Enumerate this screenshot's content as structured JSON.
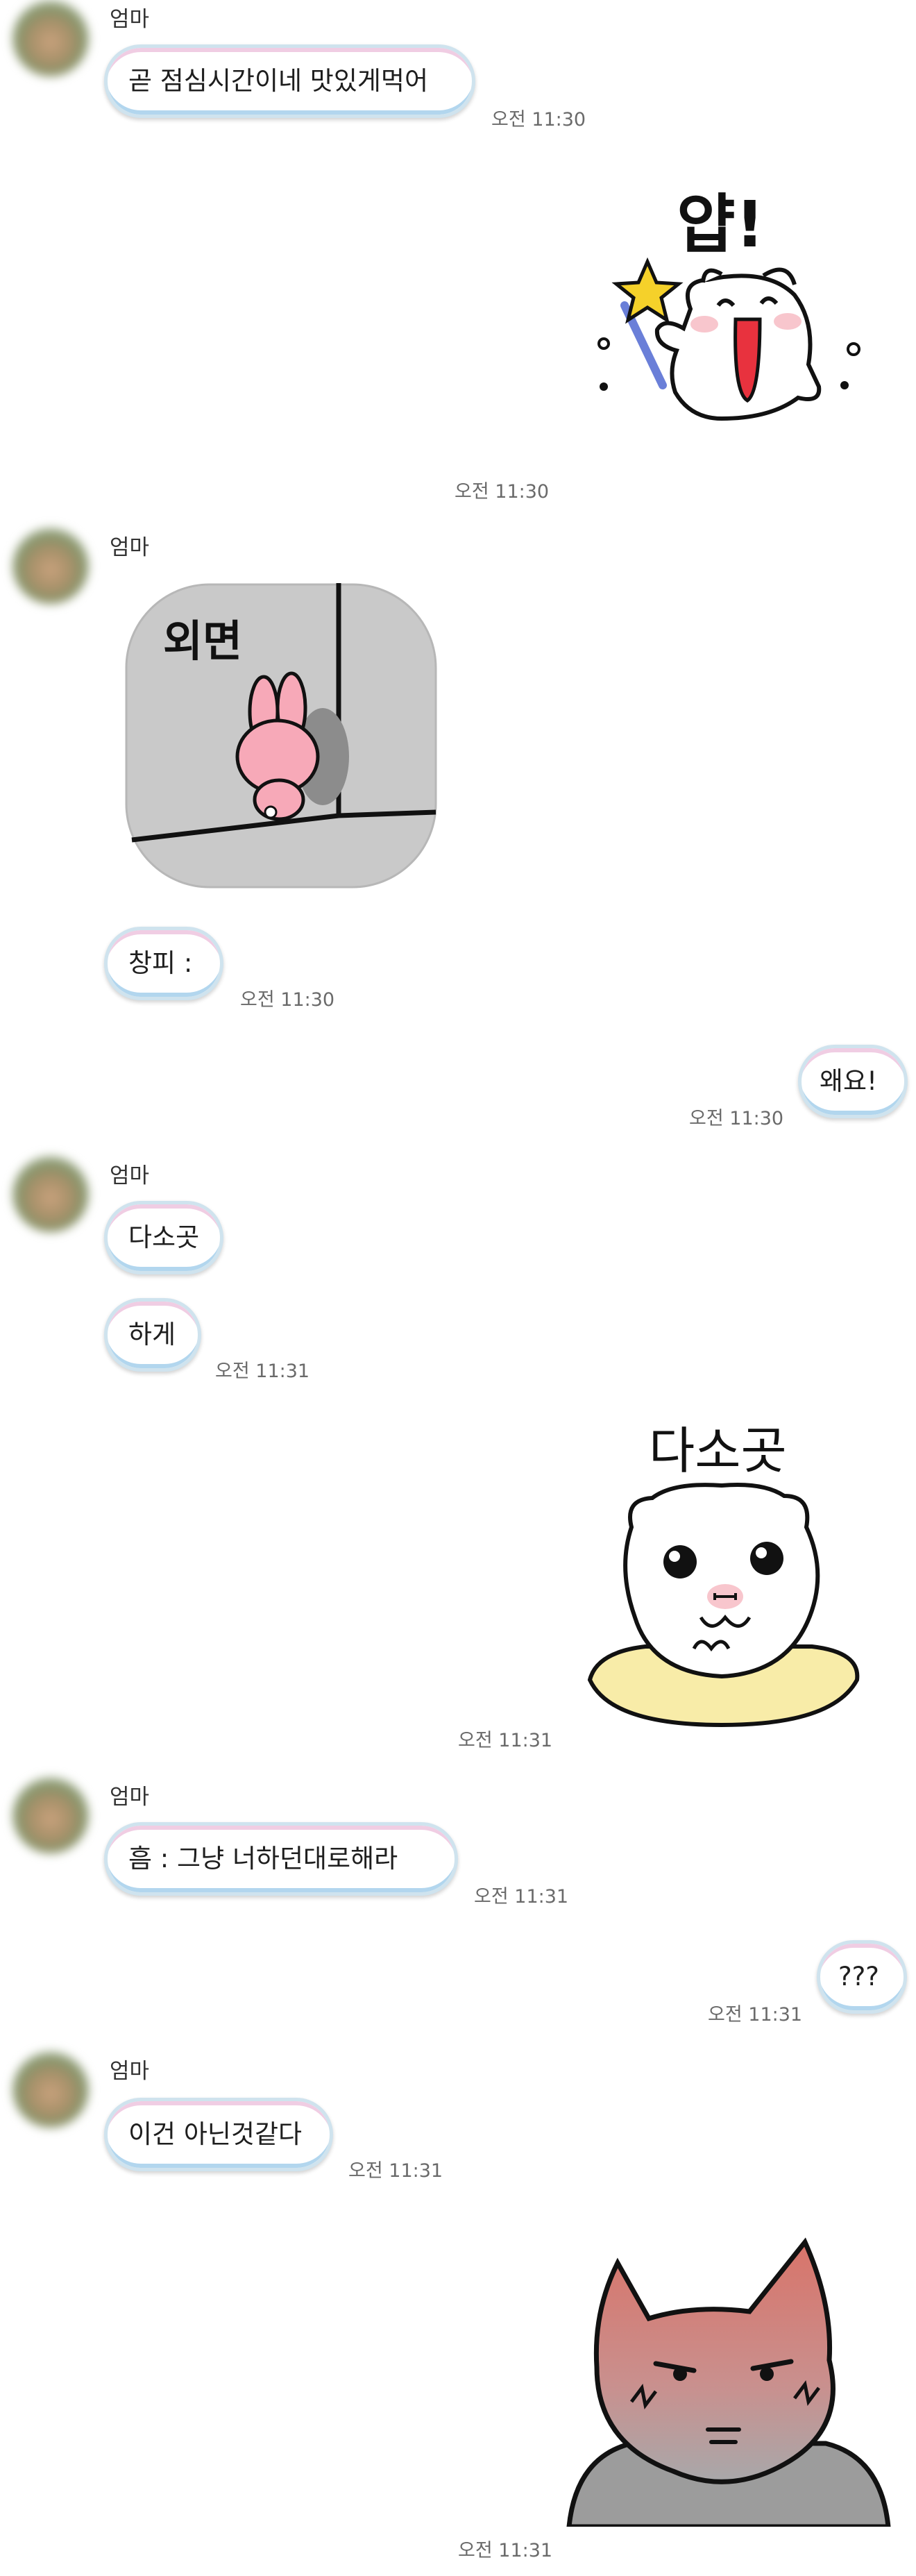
{
  "messages": {
    "m1": {
      "sender": "엄마",
      "text": "곧 점심시간이네  맛있게먹어",
      "time": "오전 11:30"
    },
    "m2": {
      "sticker": "ghost-magic-wand-sticker",
      "caption": "얍!",
      "time": "오전 11:30"
    },
    "m3": {
      "sender": "엄마",
      "sticker": "bunny-facing-corner-sticker",
      "caption": "외면"
    },
    "m4": {
      "text": "창피 :",
      "time": "오전 11:30"
    },
    "m5": {
      "text": "왜요!",
      "time": "오전 11:30"
    },
    "m6": {
      "sender": "엄마",
      "text": "다소곳"
    },
    "m7": {
      "text": "하게",
      "time": "오전 11:31"
    },
    "m8": {
      "sticker": "ghost-sitting-on-cushion-sticker",
      "caption": "다소곳",
      "time": "오전 11:31"
    },
    "m9": {
      "sender": "엄마",
      "text": "흠  : 그냥 너하던대로해라",
      "time": "오전 11:31"
    },
    "m10": {
      "text": "???",
      "time": "오전 11:31"
    },
    "m11": {
      "sender": "엄마",
      "text": "이건 아닌것같다",
      "time": "오전 11:31"
    },
    "m12": {
      "sticker": "angry-blushing-cat-sticker",
      "time": "오전 11:31"
    }
  },
  "colors": {
    "background": "#ffffff",
    "bubble_border": "#cfe3ee",
    "bubble_top_tint": "#eec8e0",
    "bubble_bottom_tint": "#aad2ec",
    "timestamp": "#6a6a6a"
  }
}
